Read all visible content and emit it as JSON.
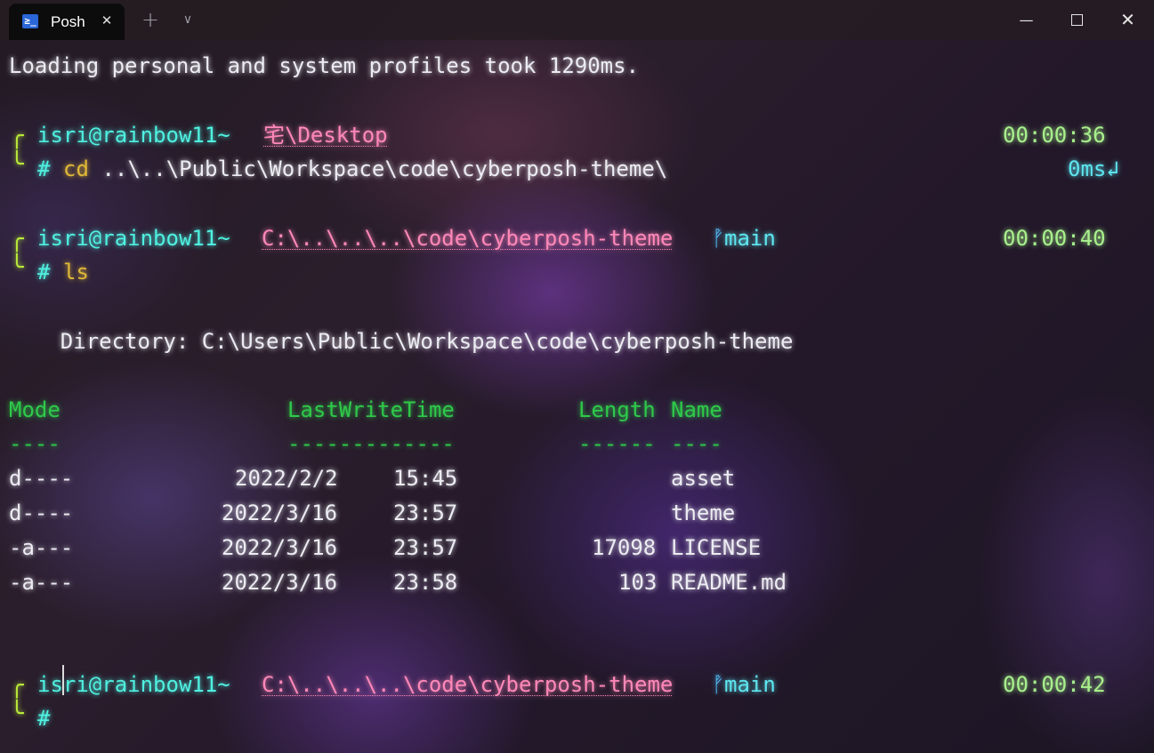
{
  "window": {
    "tab_label": "Posh",
    "tab_icon_glyph": "≥_",
    "tab_icon": "powershell-icon",
    "close_tab_glyph": "✕",
    "new_tab_glyph": "+",
    "dropdown_glyph": "∨",
    "minimize_glyph": "—",
    "close_glyph": "✕"
  },
  "terminal": {
    "load_message": "Loading personal and system profiles took 1290ms.",
    "prompt_bracket_top": "╭",
    "prompt_bracket_bottom": "╰",
    "prompts": [
      {
        "user": "isri@rainbow11~",
        "path": "宅\\Desktop",
        "branch": "",
        "time": "00:00:36",
        "symbol": "#",
        "cmd_name": "cd",
        "cmd_args": " ..\\..\\Public\\Workspace\\code\\cyberposh-theme\\",
        "duration": "0ms↲"
      },
      {
        "user": "isri@rainbow11~",
        "path": "C:\\..\\..\\..\\code\\cyberposh-theme",
        "branch": "main",
        "branch_icon": "ᚡ",
        "time": "00:00:40",
        "symbol": "#",
        "cmd_name": "ls",
        "cmd_args": ""
      },
      {
        "user": "isri@rainbow11~",
        "path": "C:\\..\\..\\..\\code\\cyberposh-theme",
        "branch": "main",
        "branch_icon": "ᚡ",
        "time": "00:00:42",
        "symbol": "#"
      }
    ],
    "directory_line": "    Directory: C:\\Users\\Public\\Workspace\\code\\cyberposh-theme",
    "listing": {
      "headers": {
        "mode": "Mode",
        "lastwrite": "LastWriteTime",
        "length": "Length",
        "name": "Name"
      },
      "underlines": {
        "mode": "----",
        "lastwrite": "-------------",
        "length": "------",
        "name": "----"
      },
      "rows": [
        {
          "mode": "d----",
          "date": "2022/2/2",
          "time": "15:45",
          "length": "",
          "name": "asset"
        },
        {
          "mode": "d----",
          "date": "2022/3/16",
          "time": "23:57",
          "length": "",
          "name": "theme"
        },
        {
          "mode": "-a---",
          "date": "2022/3/16",
          "time": "23:57",
          "length": "17098",
          "name": "LICENSE"
        },
        {
          "mode": "-a---",
          "date": "2022/3/16",
          "time": "23:58",
          "length": "103",
          "name": "README.md"
        }
      ]
    }
  },
  "colors": {
    "user": "#4ff0e0",
    "path": "#ff88b8",
    "time": "#a8f08c",
    "command": "#e0b838",
    "table_header": "#2fc94a",
    "bracket": "#b8e838"
  }
}
